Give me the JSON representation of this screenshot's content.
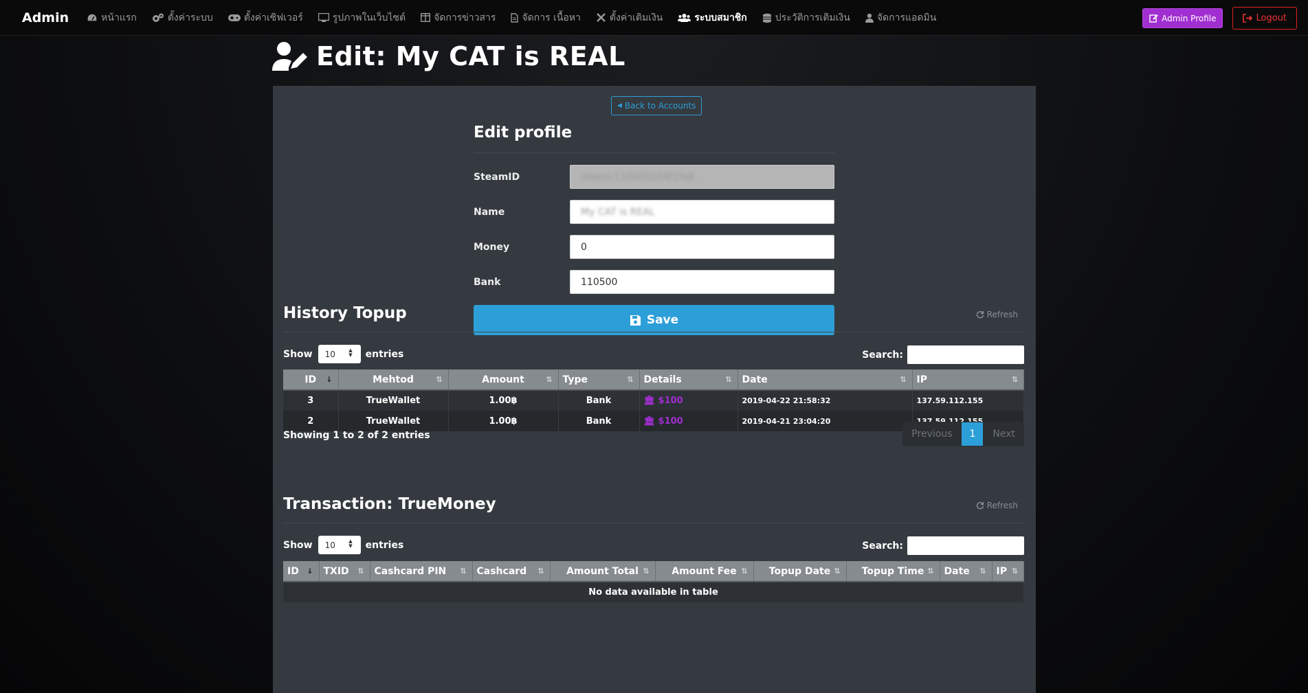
{
  "nav": {
    "brand": "Admin",
    "items": [
      {
        "label": "หน้าแรก",
        "icon": "dashboard-icon"
      },
      {
        "label": "ตั้งค่าระบบ",
        "icon": "cogs-icon"
      },
      {
        "label": "ตั้งค่าเซิฟเวอร์",
        "icon": "gamepad-icon"
      },
      {
        "label": "รูปภาพในเว็บไซต์",
        "icon": "desktop-icon"
      },
      {
        "label": "จัดการข่าวสาร",
        "icon": "columns-icon"
      },
      {
        "label": "จัดการ เนื้อหา",
        "icon": "file-icon"
      },
      {
        "label": "ตั้งค่าเติมเงิน",
        "icon": "tools-icon"
      },
      {
        "label": "ระบบสมาชิก",
        "icon": "users-icon"
      },
      {
        "label": "ประวัติการเติมเงิน",
        "icon": "coins-icon"
      },
      {
        "label": "จัดการแอดมิน",
        "icon": "user-icon"
      }
    ],
    "admin_profile": "Admin Profile",
    "logout": "Logout"
  },
  "page": {
    "title": "Edit: My CAT is REAL",
    "back": "Back to Accounts"
  },
  "form": {
    "title": "Edit profile",
    "steamid_label": "SteamID",
    "steamid_value": "steam:110000104f1fa8",
    "name_label": "Name",
    "name_value": "My CAT is REAL",
    "money_label": "Money",
    "money_value": "0",
    "bank_label": "Bank",
    "bank_value": "110500",
    "save": "Save"
  },
  "history": {
    "title": "History Topup",
    "refresh": "Refresh",
    "show": "Show",
    "entries": "entries",
    "length": "10",
    "search": "Search:",
    "columns": [
      "ID",
      "Mehtod",
      "Amount",
      "Type",
      "Details",
      "Date",
      "IP"
    ],
    "rows": [
      {
        "id": "3",
        "method": "TrueWallet",
        "amount": "1.00฿",
        "type": "Bank",
        "details": "$100",
        "date": "2019-04-22 21:58:32",
        "ip": "137.59.112.155"
      },
      {
        "id": "2",
        "method": "TrueWallet",
        "amount": "1.00฿",
        "type": "Bank",
        "details": "$100",
        "date": "2019-04-21 23:04:20",
        "ip": "137.59.112.155"
      }
    ],
    "info": "Showing 1 to 2 of 2 entries",
    "prev": "Previous",
    "page": "1",
    "next": "Next"
  },
  "transaction": {
    "title": "Transaction: TrueMoney",
    "refresh": "Refresh",
    "show": "Show",
    "entries": "entries",
    "length": "10",
    "search": "Search:",
    "columns": [
      "ID",
      "TXID",
      "Cashcard PIN",
      "Cashcard",
      "Amount Total",
      "Amount Fee",
      "Topup Date",
      "Topup Time",
      "Date",
      "IP"
    ],
    "empty": "No data available in table"
  },
  "colors": {
    "accent": "#2d9fd8",
    "purple": "#a12ed1",
    "danger": "#e33333"
  }
}
